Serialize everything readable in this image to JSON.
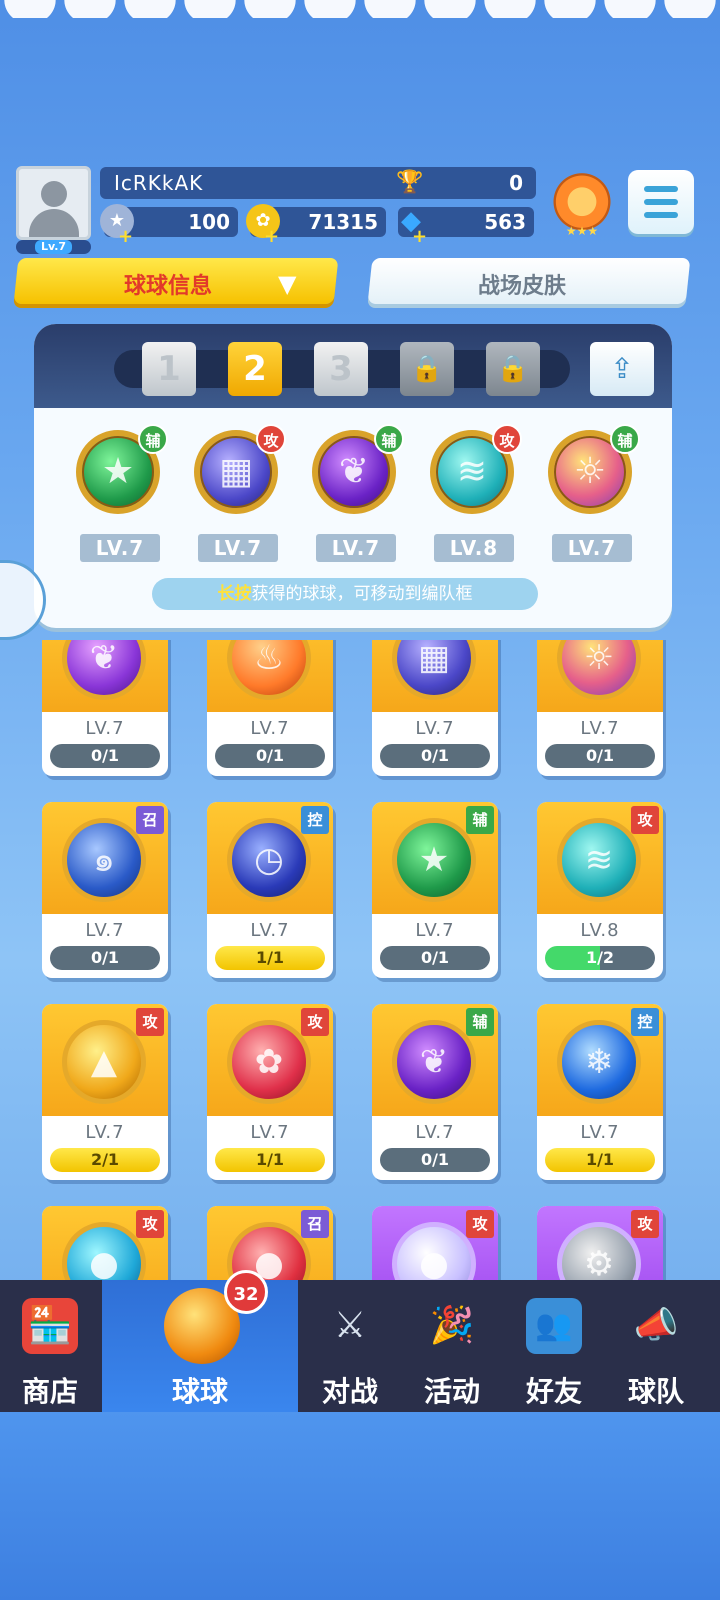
{
  "player": {
    "name": "IcRKkAK",
    "level": "Lv.7",
    "trophies": "0",
    "stamina": "100",
    "coins": "71315",
    "gems": "563"
  },
  "tabs": [
    "球球信息",
    "战场皮肤"
  ],
  "team_slots": [
    "1",
    "2",
    "3"
  ],
  "team": [
    {
      "tag": "辅",
      "level": "LV.7"
    },
    {
      "tag": "攻",
      "level": "LV.7"
    },
    {
      "tag": "辅",
      "level": "LV.7"
    },
    {
      "tag": "攻",
      "level": "LV.8"
    },
    {
      "tag": "辅",
      "level": "LV.7"
    }
  ],
  "hint": {
    "highlight": "长按",
    "rest": "获得的球球，可移动到编队框"
  },
  "cards": [
    {
      "tag": "",
      "level": "LV.7",
      "count": "0/1",
      "bar": "gray"
    },
    {
      "tag": "",
      "level": "LV.7",
      "count": "0/1",
      "bar": "gray"
    },
    {
      "tag": "",
      "level": "LV.7",
      "count": "0/1",
      "bar": "gray"
    },
    {
      "tag": "",
      "level": "LV.7",
      "count": "0/1",
      "bar": "gray"
    },
    {
      "tag": "召",
      "level": "LV.7",
      "count": "0/1",
      "bar": "gray"
    },
    {
      "tag": "控",
      "level": "LV.7",
      "count": "1/1",
      "bar": "yellow"
    },
    {
      "tag": "辅",
      "level": "LV.7",
      "count": "0/1",
      "bar": "gray"
    },
    {
      "tag": "攻",
      "level": "LV.8",
      "count": "1/2",
      "bar": "green"
    },
    {
      "tag": "攻",
      "level": "LV.7",
      "count": "2/1",
      "bar": "yellow"
    },
    {
      "tag": "攻",
      "level": "LV.7",
      "count": "1/1",
      "bar": "yellow"
    },
    {
      "tag": "辅",
      "level": "LV.7",
      "count": "0/1",
      "bar": "gray"
    },
    {
      "tag": "控",
      "level": "LV.7",
      "count": "1/1",
      "bar": "yellow"
    },
    {
      "tag": "攻"
    },
    {
      "tag": "召"
    },
    {
      "tag": "攻"
    },
    {
      "tag": "攻"
    }
  ],
  "nav": {
    "shop": "商店",
    "balls": "球球",
    "balls_badge": "32",
    "battle": "对战",
    "events": "活动",
    "friends": "好友",
    "team": "球队"
  }
}
